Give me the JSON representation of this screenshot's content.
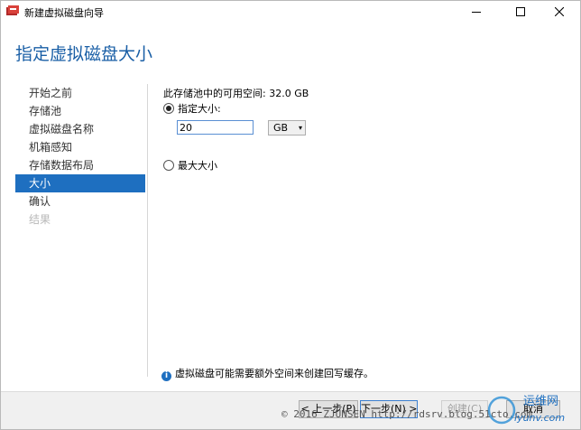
{
  "window": {
    "title": "新建虚拟磁盘向导"
  },
  "header": {
    "title": "指定虚拟磁盘大小"
  },
  "nav": {
    "items": [
      {
        "label": "开始之前",
        "state": "normal"
      },
      {
        "label": "存储池",
        "state": "normal"
      },
      {
        "label": "虚拟磁盘名称",
        "state": "normal"
      },
      {
        "label": "机箱感知",
        "state": "normal"
      },
      {
        "label": "存储数据布局",
        "state": "normal"
      },
      {
        "label": "大小",
        "state": "active"
      },
      {
        "label": "确认",
        "state": "normal"
      },
      {
        "label": "结果",
        "state": "disabled"
      }
    ]
  },
  "main": {
    "available_space": "此存储池中的可用空间: 32.0 GB",
    "option_specify": "指定大小:",
    "option_max": "最大大小",
    "selected_option": "specify",
    "size_value": "20",
    "unit_value": "GB",
    "info_text": "虚拟磁盘可能需要额外空间来创建回写缓存。"
  },
  "footer": {
    "prev_label": "< 上一步(P)",
    "next_label": "下一步(N) >",
    "create_label": "创建(C)",
    "cancel_label": "取消"
  },
  "watermark": {
    "text": "© 2016 ZJUNSEN http://rdsrv.blog.51cto.com",
    "logo_text": "运维网",
    "logo_sub": "iyunv.com"
  },
  "colors": {
    "accent": "#1e6fc0",
    "title": "#1a5fa6"
  }
}
